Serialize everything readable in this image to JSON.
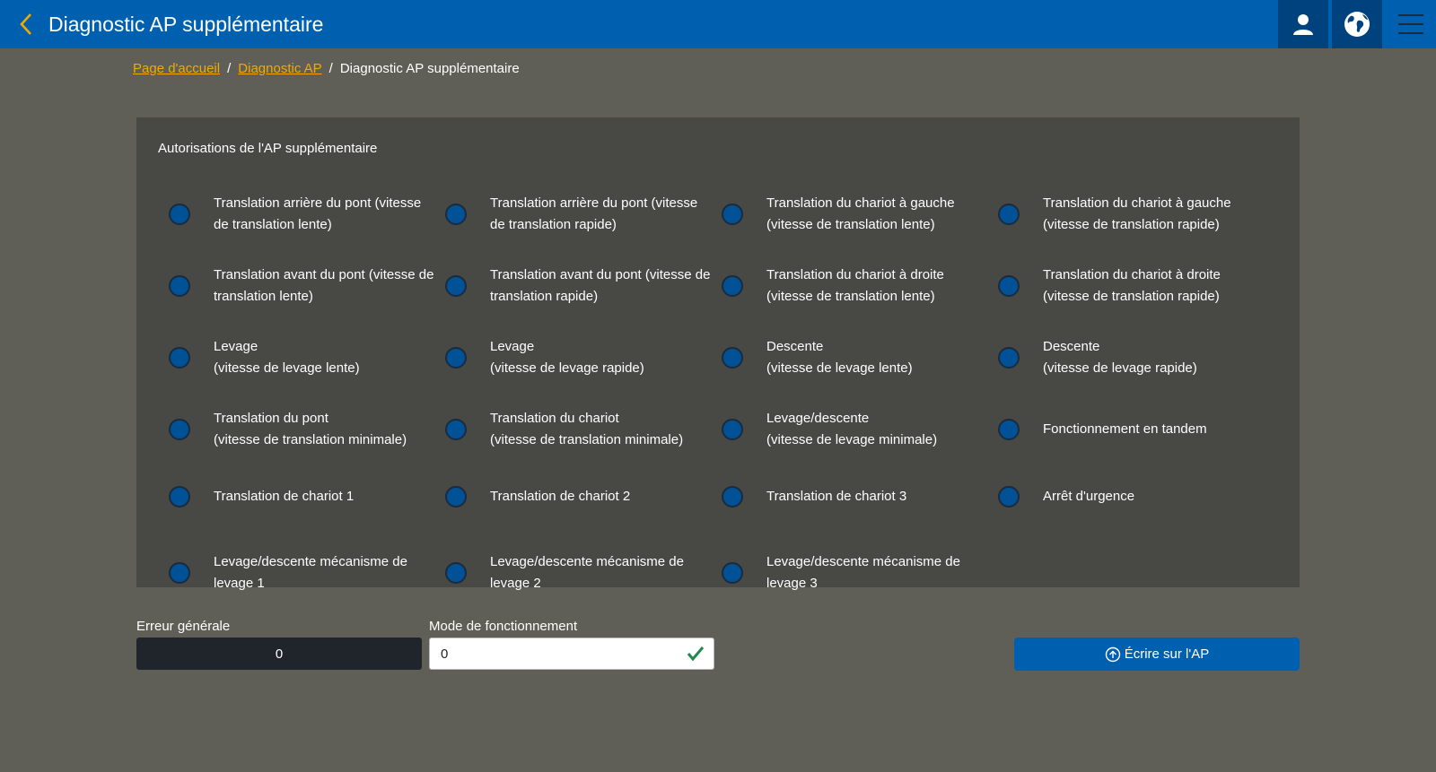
{
  "header": {
    "title": "Diagnostic AP supplémentaire"
  },
  "breadcrumb": {
    "home": "Page d'accueil",
    "parent": "Diagnostic AP",
    "current": "Diagnostic AP supplémentaire",
    "separator": "/"
  },
  "panel": {
    "title": "Autorisations de l'AP supplémentaire",
    "items": [
      "Translation arrière du pont (vitesse\nde translation lente)",
      "Translation arrière du pont (vitesse\nde translation rapide)",
      "Translation du chariot à gauche\n(vitesse de translation lente)",
      "Translation du chariot à gauche\n(vitesse de translation rapide)",
      "Translation avant du pont (vitesse de\ntranslation lente)",
      "Translation avant du pont (vitesse de\ntranslation rapide)",
      "Translation du chariot à droite\n(vitesse de translation lente)",
      "Translation du chariot à droite\n(vitesse de translation rapide)",
      "Levage\n(vitesse de levage lente)",
      "Levage\n(vitesse de levage rapide)",
      "Descente\n(vitesse de levage lente)",
      "Descente\n(vitesse de levage rapide)",
      "Translation du pont\n(vitesse de translation minimale)",
      "Translation du chariot\n(vitesse de translation minimale)",
      "Levage/descente\n(vitesse de levage minimale)",
      "Fonctionnement en tandem",
      "Translation de chariot 1",
      "Translation de chariot 2",
      "Translation de chariot 3",
      "Arrêt d'urgence",
      "Levage/descente mécanisme de\nlevage 1",
      "Levage/descente mécanisme de\nlevage 2",
      "Levage/descente mécanisme de\nlevage 3"
    ]
  },
  "fields": {
    "error_label": "Erreur générale",
    "error_value": "0",
    "mode_label": "Mode de fonctionnement",
    "mode_value": "0"
  },
  "actions": {
    "write_label": "Écrire sur l'AP"
  },
  "colors": {
    "header": "#0060b0",
    "accent": "#f2a900",
    "indicator": "#005196",
    "ok": "#1e8a4c"
  }
}
